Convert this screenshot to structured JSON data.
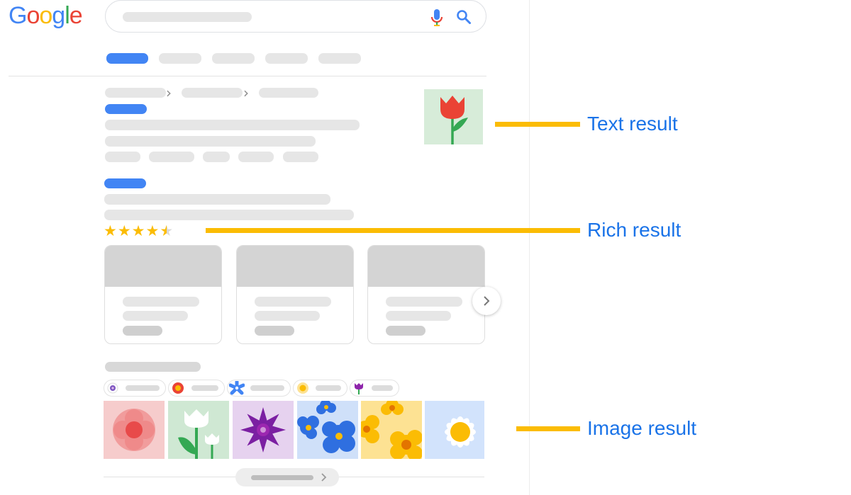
{
  "logo": {
    "text": "Google",
    "colors": [
      "#4285F4",
      "#EA4335",
      "#FBBC05",
      "#4285F4",
      "#34A853",
      "#EA4335"
    ]
  },
  "search": {
    "mic_icon": "mic-icon",
    "search_icon": "search-icon"
  },
  "rating": {
    "stars_text": "★★★★",
    "half_star": "★",
    "value": 4.5,
    "max": 5
  },
  "annotations": {
    "text_result": "Text result",
    "rich_result": "Rich result",
    "image_result": "Image result"
  },
  "colors": {
    "accent": "#4285f4",
    "annotation_line": "#fbbc04",
    "annotation_text": "#1a73e8",
    "placeholder": "#e6e6e6"
  },
  "icons": {
    "breadcrumb_separator": "chevron-right-icon",
    "carousel_next": "chevron-right-icon",
    "thumbnail": "tulip-icon",
    "chip_icons": [
      "purple-flower-icon",
      "red-flower-icon",
      "blue-flower-icon",
      "yellow-flower-icon",
      "purple-tulip-icon"
    ],
    "image_tiles": [
      "pink-flower-image",
      "white-tulips-image",
      "purple-flower-image",
      "blue-flowers-image",
      "yellow-flowers-image",
      "daisy-image"
    ]
  }
}
